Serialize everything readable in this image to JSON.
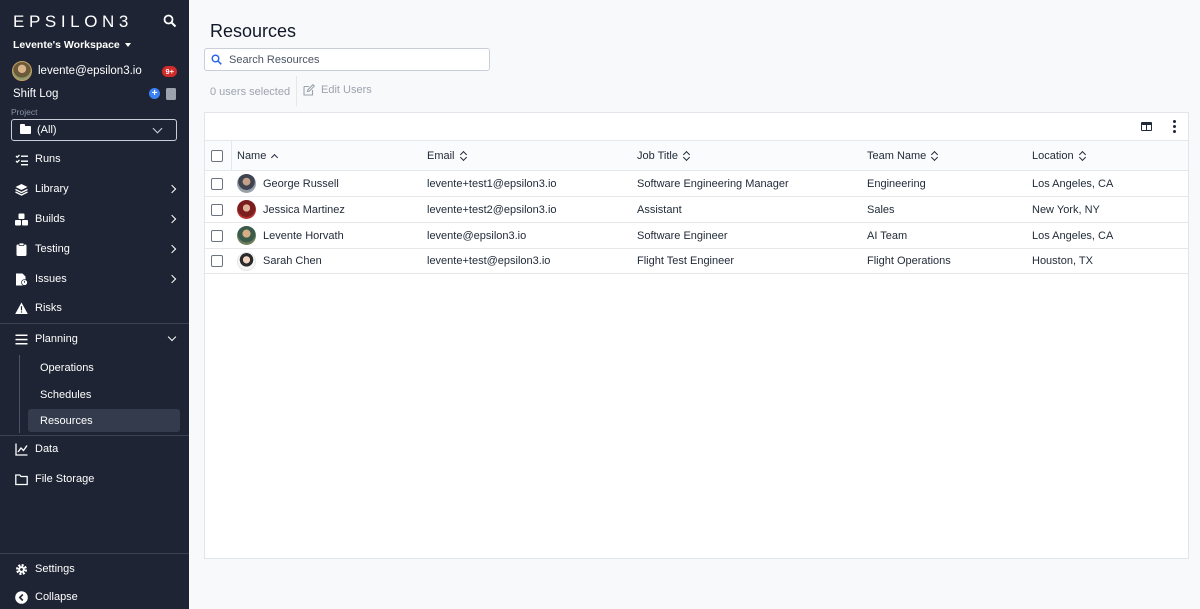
{
  "sidebar": {
    "logo": "EPSILON3",
    "workspace": "Levente's Workspace",
    "user_email": "levente@epsilon3.io",
    "notification_badge": "9+",
    "shift_log": "Shift Log",
    "project_label": "Project",
    "project_value": "(All)",
    "nav": [
      {
        "label": "Runs",
        "icon": "runs-icon"
      },
      {
        "label": "Library",
        "icon": "library-icon"
      },
      {
        "label": "Builds",
        "icon": "builds-icon"
      },
      {
        "label": "Testing",
        "icon": "testing-icon"
      },
      {
        "label": "Issues",
        "icon": "issues-icon"
      },
      {
        "label": "Risks",
        "icon": "risks-icon"
      },
      {
        "label": "Planning",
        "icon": "planning-icon"
      }
    ],
    "planning_sub": [
      "Operations",
      "Schedules",
      "Resources"
    ],
    "nav_after": [
      {
        "label": "Data",
        "icon": "data-icon"
      },
      {
        "label": "File Storage",
        "icon": "folder-icon"
      }
    ],
    "settings": "Settings",
    "collapse": "Collapse"
  },
  "main": {
    "title": "Resources",
    "search_placeholder": "Search Resources",
    "selected_count": "0 users selected",
    "edit_users": "Edit Users",
    "columns": [
      "Name",
      "Email",
      "Job Title",
      "Team Name",
      "Location"
    ],
    "rows": [
      {
        "name": "George Russell",
        "email": "levente+test1@epsilon3.io",
        "job": "Software Engineering Manager",
        "team": "Engineering",
        "location": "Los Angeles, CA"
      },
      {
        "name": "Jessica Martinez",
        "email": "levente+test2@epsilon3.io",
        "job": "Assistant",
        "team": "Sales",
        "location": "New York, NY"
      },
      {
        "name": "Levente Horvath",
        "email": "levente@epsilon3.io",
        "job": "Software Engineer",
        "team": "AI Team",
        "location": "Los Angeles, CA"
      },
      {
        "name": "Sarah Chen",
        "email": "levente+test@epsilon3.io",
        "job": "Flight Test Engineer",
        "team": "Flight Operations",
        "location": "Houston, TX"
      }
    ]
  }
}
